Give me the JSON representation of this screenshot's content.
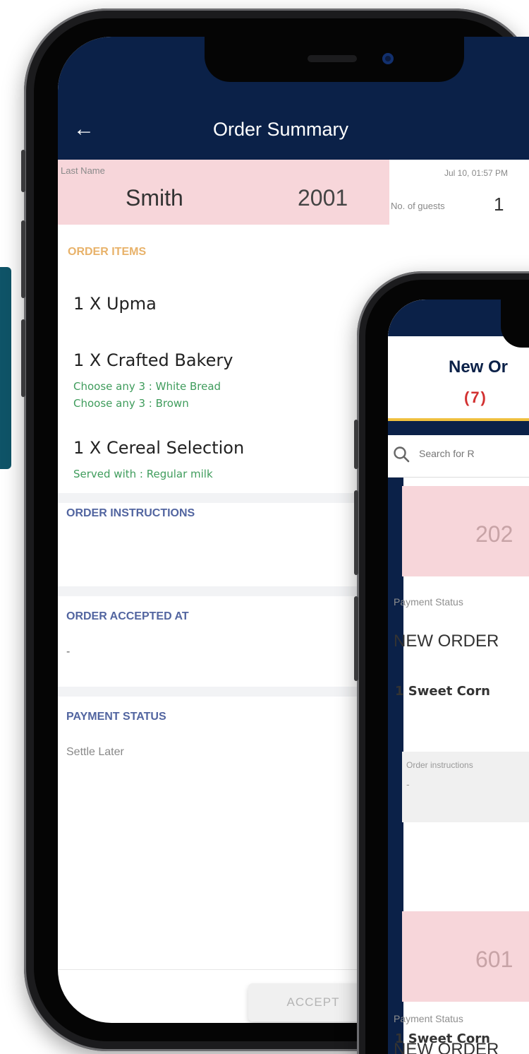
{
  "order_summary": {
    "header": {
      "back_icon": "back-arrow-icon",
      "title": "Order Summary"
    },
    "customer": {
      "last_name_label": "Last Name",
      "last_name": "Smith",
      "room_number": "2001",
      "order_time": "Jul 10, 01:57 PM",
      "guests_label": "No. of guests",
      "guests": "1"
    },
    "order_items": {
      "title": "ORDER ITEMS",
      "items": [
        {
          "label": "1 X Upma",
          "options": []
        },
        {
          "label": "1 X Crafted Bakery",
          "options": [
            "Choose any 3 : White Bread",
            "Choose any 3 : Brown"
          ]
        },
        {
          "label": "1 X Cereal Selection",
          "options": [
            "Served with : Regular milk"
          ]
        }
      ]
    },
    "instructions": {
      "title": "ORDER INSTRUCTIONS",
      "value": ""
    },
    "accepted_at": {
      "title": "ORDER ACCEPTED AT",
      "value": "-"
    },
    "payment_status": {
      "title": "PAYMENT STATUS",
      "value": "Settle Later"
    },
    "accept_button": "ACCEPT"
  },
  "new_orders": {
    "title": "New Or",
    "count": "(7)",
    "search": {
      "placeholder": "Search for R",
      "icon": "search-icon"
    },
    "cards": [
      {
        "room": "202",
        "payment_label": "Payment Status",
        "status": "NEW ORDER",
        "item": "1  Sweet Corn",
        "instructions_label": "Order instructions",
        "instructions_value": "-"
      },
      {
        "room": "601",
        "payment_label": "Payment Status",
        "status": "NEW ORDER",
        "item": "1  Sweet Corn"
      }
    ]
  },
  "colors": {
    "navy": "#0b2148",
    "pink_band": "#f7d6da",
    "section_orange": "#e8b26a",
    "section_blue": "#5265a0",
    "option_green": "#3f9c5c",
    "count_red": "#d23030",
    "tab_yellow": "#f0c040",
    "teal_accent": "#0f5468"
  }
}
